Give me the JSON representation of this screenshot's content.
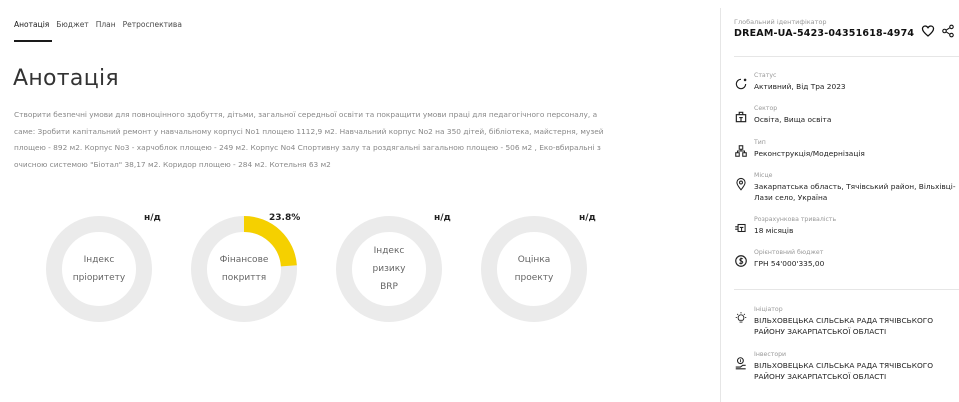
{
  "tabs": [
    {
      "label": "Анотація",
      "active": true
    },
    {
      "label": "Бюджет",
      "active": false
    },
    {
      "label": "План",
      "active": false
    },
    {
      "label": "Ретроспектива",
      "active": false
    }
  ],
  "main": {
    "title": "Анотація",
    "description": "Створити безпечні умови для повноцінного здобуття, дітьми, загальної середньої освіти та покращити умови праці для педагогічного персоналу, а саме: Зробити капітальний ремонт у навчальному корпусі No1 площею 1112,9 м2. Навчальний корпус No2 на 350 дітей, бібліотека, майстерня, музей площею - 892 м2. Корпус No3 - харчоблок площею - 249 м2. Корпус No4 Спортивну залу та роздягальні загальною площею - 506 м2 , Еко-вбиральні з очисною системою \"Біотал\" 38,17 м2. Коридор площею - 284 м2. Котельня 63 м2"
  },
  "gauges": [
    {
      "label": "Індекс пріоритету",
      "value": "н/д",
      "fraction": 0
    },
    {
      "label": "Фінансове покриття",
      "value": "23.8%",
      "fraction": 0.238
    },
    {
      "label": "Індекс ризику ВRP",
      "value": "н/д",
      "fraction": 0
    },
    {
      "label": "Оцінка проекту",
      "value": "н/д",
      "fraction": 0
    }
  ],
  "colors": {
    "gauge_track": "#ebebeb",
    "gauge_fill": "#f5d000"
  },
  "sidebar": {
    "global_id_label": "Глобальний ідентифікатор",
    "global_id": "DREAM-UA-5423-04351618-4974",
    "status": {
      "label": "Статус",
      "value": "Активний, Від Тра 2023",
      "icon": "status-icon"
    },
    "sector": {
      "label": "Сектор",
      "value": "Освіта, Вища освіта",
      "icon": "building-icon"
    },
    "type": {
      "label": "Тип",
      "value": "Реконструкція/Модернізація",
      "icon": "structure-icon"
    },
    "place": {
      "label": "Місце",
      "value": "Закарпатська область, Тячівський район, Вільхівці-Лази село, Україна",
      "icon": "location-icon"
    },
    "duration": {
      "label": "Розрахункова тривалість",
      "value": "18 місяців",
      "icon": "duration-icon"
    },
    "budget": {
      "label": "Орієнтовний бюджет",
      "value": "ГРН 54'000'335,00",
      "icon": "money-icon"
    },
    "initiator": {
      "label": "Ініціатор",
      "value": "ВІЛЬХОВЕЦЬКА СІЛЬСЬКА РАДА ТЯЧІВСЬКОГО РАЙОНУ ЗАКАРПАТСЬКОЇ ОБЛАСТІ",
      "icon": "lightbulb-icon"
    },
    "investors": {
      "label": "Інвестори",
      "value": "ВІЛЬХОВЕЦЬКА СІЛЬСЬКА РАДА ТЯЧІВСЬКОГО РАЙОНУ ЗАКАРПАТСЬКОЇ ОБЛАСТІ",
      "icon": "investor-icon"
    }
  }
}
